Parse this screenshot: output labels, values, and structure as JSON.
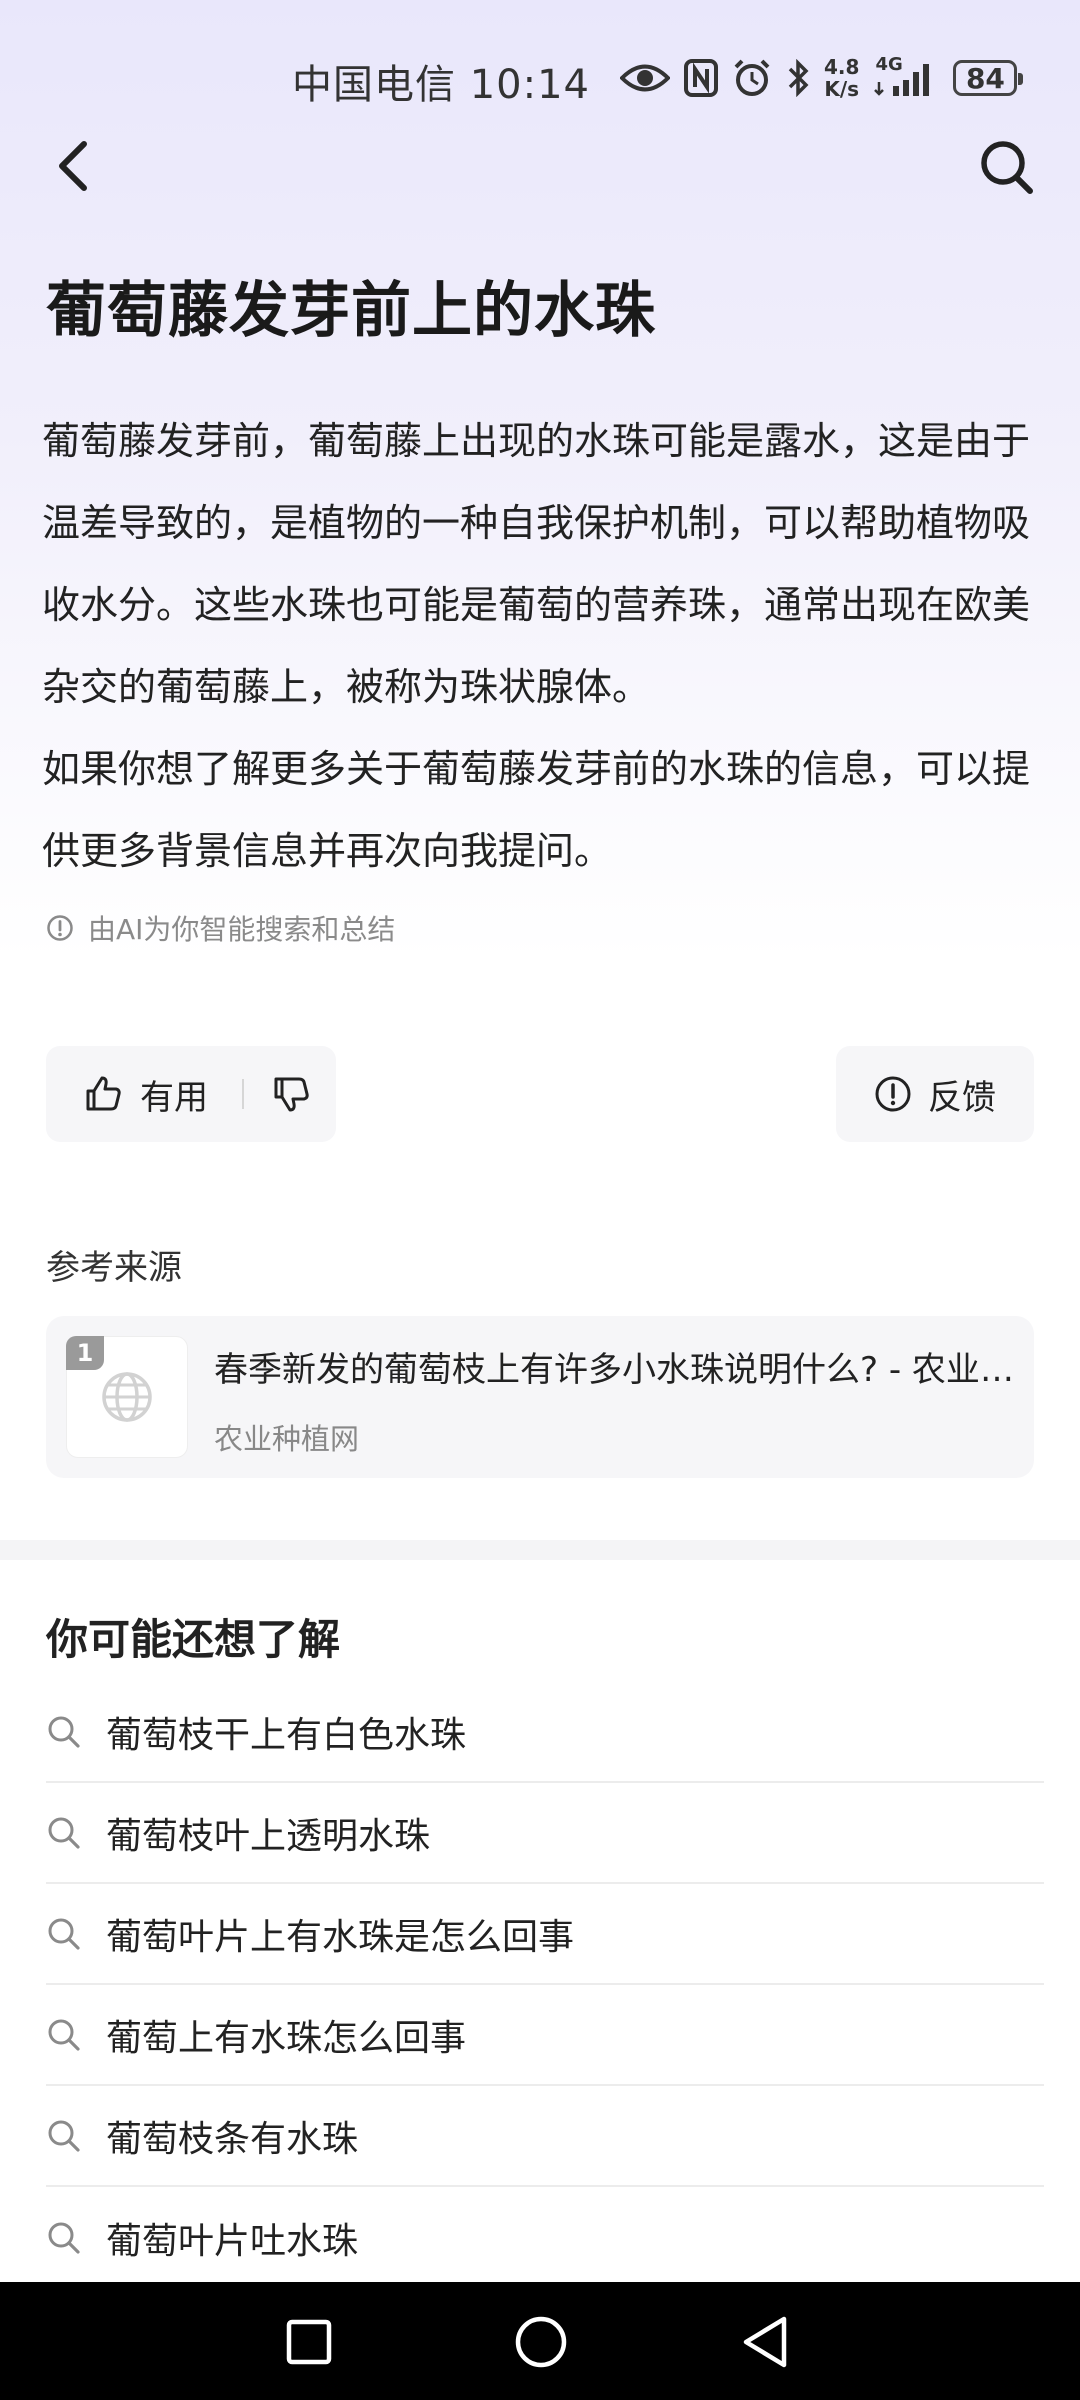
{
  "status_bar": {
    "carrier_time": "中国电信 10:14",
    "net_speed_value": "4.8",
    "net_speed_unit": "K/s",
    "network": "4G",
    "battery": "84"
  },
  "article": {
    "title": "葡萄藤发芽前上的水珠",
    "paragraph1": "葡萄藤发芽前，葡萄藤上出现的水珠可能是露水，这是由于温差导致的，是植物的一种自我保护机制，可以帮助植物吸收水分。这些水珠也可能是葡萄的营养珠，通常出现在欧美杂交的葡萄藤上，被称为珠状腺体。",
    "paragraph2": "如果你想了解更多关于葡萄藤发芽前的水珠的信息，可以提供更多背景信息并再次向我提问。",
    "ai_note": "由AI为你智能搜索和总结"
  },
  "feedback": {
    "useful_label": "有用",
    "report_label": "反馈"
  },
  "references": {
    "heading": "参考来源",
    "items": [
      {
        "index": "1",
        "title": "春季新发的葡萄枝上有许多小水珠说明什么? - 农业种植网",
        "source": "农业种植网"
      }
    ]
  },
  "related": {
    "heading": "你可能还想了解",
    "items": [
      "葡萄枝干上有白色水珠",
      "葡萄枝叶上透明水珠",
      "葡萄叶片上有水珠是怎么回事",
      "葡萄上有水珠怎么回事",
      "葡萄枝条有水珠",
      "葡萄叶片吐水珠"
    ]
  },
  "colors": {
    "header_gradient_top": "#e9e7fb",
    "text_primary": "#222222",
    "text_secondary": "#888888",
    "card_bg": "#f6f6f8",
    "nav_bar": "#000000"
  },
  "icons": {
    "back": "chevron-left-icon",
    "search": "search-icon",
    "info": "info-circle-icon",
    "thumb_up": "thumb-up-icon",
    "thumb_down": "thumb-down-icon",
    "globe": "globe-icon",
    "related_search": "search-icon"
  }
}
